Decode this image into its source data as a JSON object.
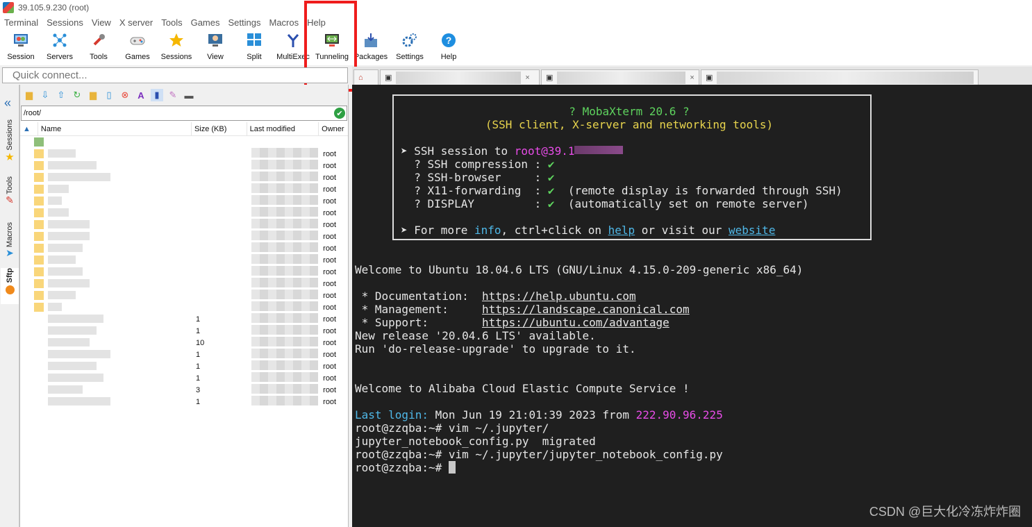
{
  "window": {
    "title": "39.105.9.230 (root)"
  },
  "menu": [
    "Terminal",
    "Sessions",
    "View",
    "X server",
    "Tools",
    "Games",
    "Settings",
    "Macros",
    "Help"
  ],
  "toolbar": [
    {
      "label": "Session",
      "icon": "monitor-session-icon"
    },
    {
      "label": "Servers",
      "icon": "servers-icon"
    },
    {
      "label": "Tools",
      "icon": "tools-icon"
    },
    {
      "label": "Games",
      "icon": "gamepad-icon"
    },
    {
      "label": "Sessions",
      "icon": "star-icon"
    },
    {
      "label": "View",
      "icon": "view-icon"
    },
    {
      "label": "Split",
      "icon": "split-icon"
    },
    {
      "label": "MultiExec",
      "icon": "multiexec-icon"
    },
    {
      "label": "Tunneling",
      "icon": "tunneling-icon"
    },
    {
      "label": "Packages",
      "icon": "packages-icon"
    },
    {
      "label": "Settings",
      "icon": "gear-icon"
    },
    {
      "label": "Help",
      "icon": "help-icon"
    }
  ],
  "quick_connect": {
    "placeholder": "Quick connect..."
  },
  "side_tabs": [
    "Sessions",
    "Tools",
    "Macros",
    "Sftp"
  ],
  "sftp": {
    "path": "/root/",
    "columns": {
      "name": "Name",
      "size": "Size (KB)",
      "modified": "Last modified",
      "owner": "Owner"
    },
    "rows": [
      {
        "size": "",
        "owner": "root"
      },
      {
        "size": "",
        "owner": "root"
      },
      {
        "size": "",
        "owner": "root"
      },
      {
        "size": "",
        "owner": "root"
      },
      {
        "size": "",
        "owner": "root"
      },
      {
        "size": "",
        "owner": "root"
      },
      {
        "size": "",
        "owner": "root"
      },
      {
        "size": "",
        "owner": "root"
      },
      {
        "size": "",
        "owner": "root"
      },
      {
        "size": "",
        "owner": "root"
      },
      {
        "size": "",
        "owner": "root"
      },
      {
        "size": "",
        "owner": "root"
      },
      {
        "size": "",
        "owner": "root"
      },
      {
        "size": "",
        "owner": "root"
      },
      {
        "size": "1",
        "owner": "root"
      },
      {
        "size": "1",
        "owner": "root"
      },
      {
        "size": "10",
        "owner": "root"
      },
      {
        "size": "1",
        "owner": "root"
      },
      {
        "size": "1",
        "owner": "root"
      },
      {
        "size": "1",
        "owner": "root"
      },
      {
        "size": "3",
        "owner": "root"
      },
      {
        "size": "1",
        "owner": "root"
      }
    ]
  },
  "terminal": {
    "banner_title": "? MobaXterm 20.6 ?",
    "banner_sub": "(SSH client, X-server and networking tools)",
    "ssh_session": "➤ SSH session to ",
    "ssh_user": "root",
    "ssh_host": "@39.1",
    "features": [
      {
        "name": "  ? SSH compression : ",
        "mark": "✔",
        "note": ""
      },
      {
        "name": "  ? SSH-browser     : ",
        "mark": "✔",
        "note": ""
      },
      {
        "name": "  ? X11-forwarding  : ",
        "mark": "✔",
        "note": "  (remote display is forwarded through SSH)"
      },
      {
        "name": "  ? DISPLAY         : ",
        "mark": "✔",
        "note": "  (automatically set on remote server)"
      }
    ],
    "more_pre": "➤ For more ",
    "more_info": "info",
    "more_mid": ", ctrl+click on ",
    "more_help": "help",
    "more_or": " or visit our ",
    "more_website": "website",
    "welcome": "Welcome to Ubuntu 18.04.6 LTS (GNU/Linux 4.15.0-209-generic x86_64)",
    "doc_label": " * Documentation:  ",
    "doc_url": "https://help.ubuntu.com",
    "mgmt_label": " * Management:     ",
    "mgmt_url": "https://landscape.canonical.com",
    "support_label": " * Support:        ",
    "support_url": "https://ubuntu.com/advantage",
    "release1": "New release '20.04.6 LTS' available.",
    "release2": "Run 'do-release-upgrade' to upgrade to it.",
    "aliyun": "Welcome to Alibaba Cloud Elastic Compute Service !",
    "last_login_label": "Last login:",
    "last_login_time": " Mon Jun 19 21:01:39 2023 from ",
    "last_login_ip": "222.90.96.225",
    "cmd1": "root@zzqba:~# vim ~/.jupyter/",
    "ls_out": "jupyter_notebook_config.py  migrated",
    "cmd2": "root@zzqba:~# vim ~/.jupyter/jupyter_notebook_config.py",
    "prompt": "root@zzqba:~# "
  },
  "watermark": "CSDN @巨大化冷冻炸炸圈"
}
